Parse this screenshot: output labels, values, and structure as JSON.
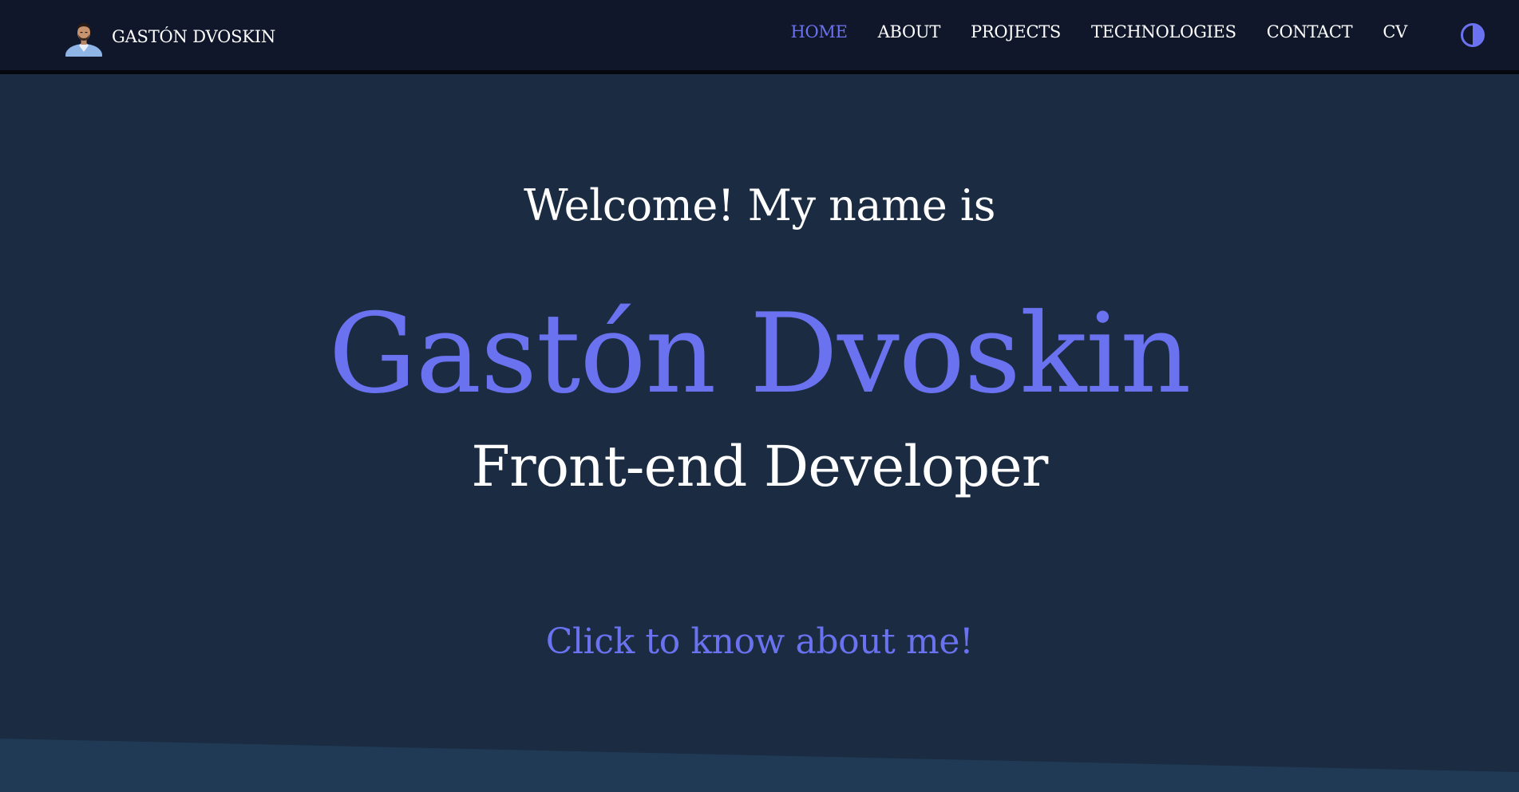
{
  "header": {
    "brand_name": "GASTÓN DVOSKIN",
    "nav": [
      {
        "label": "HOME",
        "active": true
      },
      {
        "label": "ABOUT",
        "active": false
      },
      {
        "label": "PROJECTS",
        "active": false
      },
      {
        "label": "TECHNOLOGIES",
        "active": false
      },
      {
        "label": "CONTACT",
        "active": false
      },
      {
        "label": "CV",
        "active": false
      }
    ],
    "theme_toggle_icon": "contrast-half-circle-icon"
  },
  "hero": {
    "welcome": "Welcome! My name is",
    "name": "Gastón Dvoskin",
    "role": "Front-end Developer",
    "cta": "Click to know about me!"
  },
  "colors": {
    "background": "#1a2b42",
    "navbar": "#10172b",
    "accent": "#6a72ef",
    "text": "#ffffff",
    "next_section": "#203a55"
  }
}
